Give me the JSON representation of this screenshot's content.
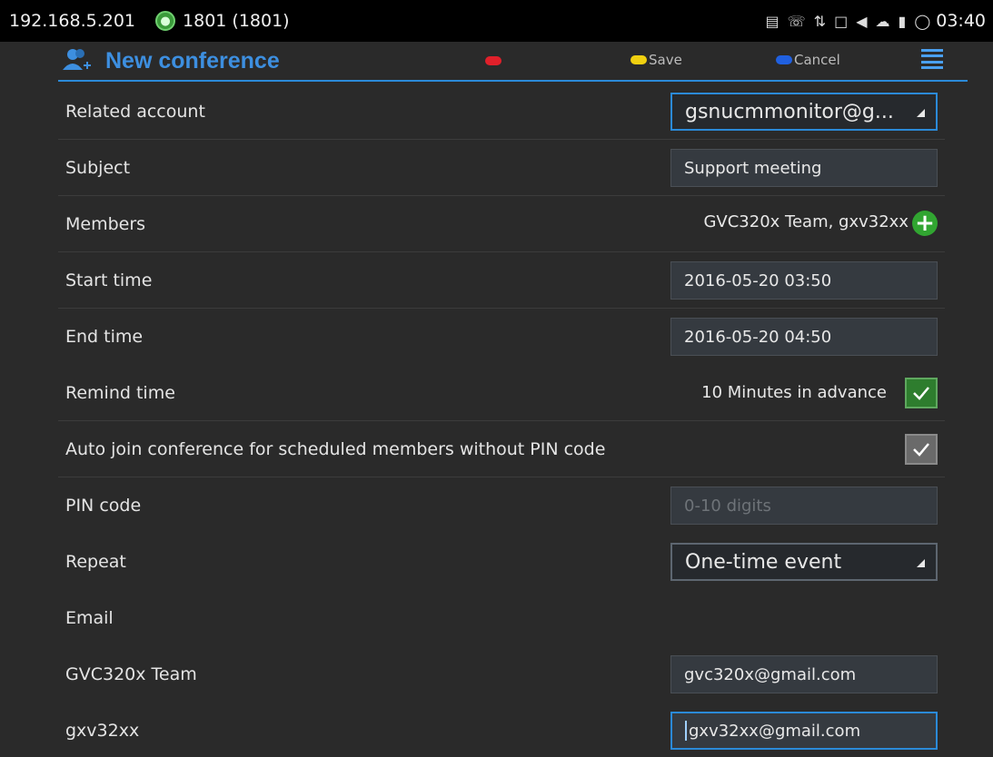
{
  "statusbar": {
    "ip": "192.168.5.201",
    "account": "1801 (1801)",
    "clock": "03:40",
    "icons": [
      "screen-icon",
      "call-icon",
      "sync-icon",
      "lock-icon",
      "volume-icon",
      "cloud-icon",
      "battery-icon",
      "refresh-icon"
    ]
  },
  "actionbar": {
    "title": "New conference",
    "save_label": "Save",
    "cancel_label": "Cancel",
    "colors": {
      "red": "#e0202a",
      "yellow": "#f0d010",
      "blue": "#2060e0",
      "accent": "#2b8ad8"
    }
  },
  "form": {
    "related_account": {
      "label": "Related account",
      "value": "gsnucmmonitor@g..."
    },
    "subject": {
      "label": "Subject",
      "value": "Support meeting"
    },
    "members": {
      "label": "Members",
      "value": "GVC320x Team, gxv32xx"
    },
    "start_time": {
      "label": "Start time",
      "value": "2016-05-20 03:50"
    },
    "end_time": {
      "label": "End time",
      "value": "2016-05-20 04:50"
    },
    "remind_time": {
      "label": "Remind time",
      "value": "10 Minutes in advance",
      "checked": true
    },
    "auto_join": {
      "label": "Auto join conference for scheduled members without PIN code",
      "checked": true
    },
    "pin_code": {
      "label": "PIN code",
      "placeholder": "0-10 digits",
      "value": ""
    },
    "repeat": {
      "label": "Repeat",
      "value": "One-time event"
    },
    "email": {
      "label": "Email"
    },
    "email_rows": [
      {
        "label": "GVC320x Team",
        "value": "gvc320x@gmail.com"
      },
      {
        "label": "gxv32xx",
        "value": "gxv32xx@gmail.com"
      }
    ]
  }
}
